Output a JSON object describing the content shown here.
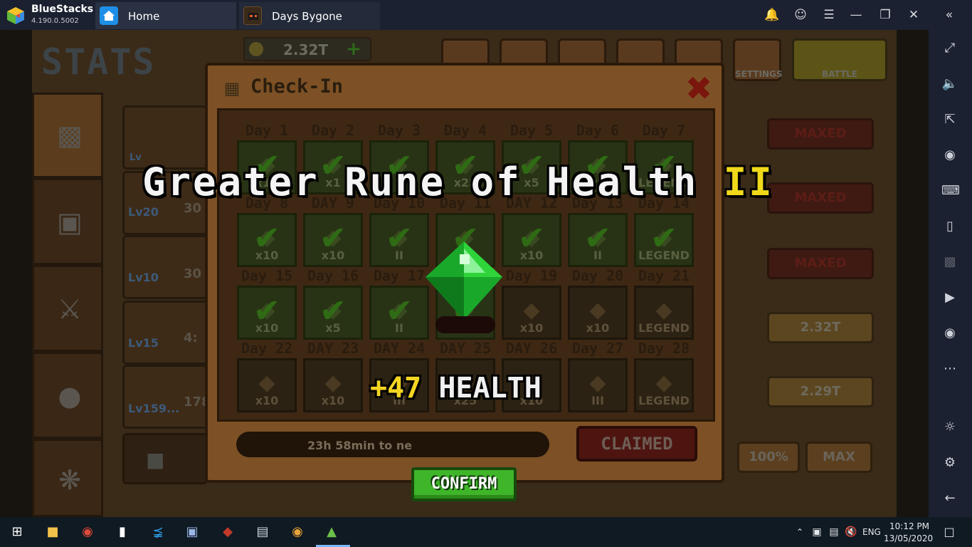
{
  "window": {
    "app_name": "BlueStacks 1",
    "app_version": "4.190.0.5002",
    "tabs": [
      {
        "label": "Home"
      },
      {
        "label": "Days Bygone"
      }
    ]
  },
  "game": {
    "screen_title": "STATS",
    "coins": "2.32T",
    "top_buttons": [
      {
        "label": "SETTINGS"
      },
      {
        "label": "BATTLE"
      }
    ],
    "stat_rows": [
      {
        "level": "Lv",
        "right": "MAXED"
      },
      {
        "level": "Lv20",
        "value": "30",
        "right": "MAXED"
      },
      {
        "level": "Lv10",
        "value": "30",
        "right": "MAXED"
      },
      {
        "level": "Lv15",
        "value": "4:",
        "right": "2.32T"
      },
      {
        "level": "Lv159...",
        "value": "178",
        "right": "2.29T"
      }
    ],
    "bottom_buttons": [
      "100%",
      "MAX"
    ]
  },
  "checkin": {
    "title": "Check-In",
    "days": [
      {
        "label": "Day 1",
        "qty": "x10",
        "claimed": true
      },
      {
        "label": "Day 2",
        "qty": "x1",
        "claimed": true
      },
      {
        "label": "Day 3",
        "qty": "I",
        "claimed": true
      },
      {
        "label": "Day 4",
        "qty": "x25",
        "claimed": true
      },
      {
        "label": "Day 5",
        "qty": "x5",
        "claimed": true
      },
      {
        "label": "Day 6",
        "qty": "x5",
        "claimed": true
      },
      {
        "label": "Day 7",
        "qty": "LEGEND",
        "claimed": true
      },
      {
        "label": "Day 8",
        "qty": "x10",
        "claimed": true
      },
      {
        "label": "DAY 9",
        "qty": "x10",
        "claimed": true
      },
      {
        "label": "Day 10",
        "qty": "II",
        "claimed": true
      },
      {
        "label": "Day 11",
        "qty": "",
        "claimed": true
      },
      {
        "label": "DAY 12",
        "qty": "x10",
        "claimed": true
      },
      {
        "label": "Day 13",
        "qty": "II",
        "claimed": true
      },
      {
        "label": "Day 14",
        "qty": "LEGEND",
        "claimed": true
      },
      {
        "label": "Day 15",
        "qty": "x10",
        "claimed": true
      },
      {
        "label": "Day 16",
        "qty": "x5",
        "claimed": true
      },
      {
        "label": "Day 17",
        "qty": "II",
        "claimed": true
      },
      {
        "label": "",
        "qty": "",
        "claimed": true
      },
      {
        "label": "Day 19",
        "qty": "x10",
        "claimed": false
      },
      {
        "label": "Day 20",
        "qty": "x10",
        "claimed": false
      },
      {
        "label": "Day 21",
        "qty": "LEGEND",
        "claimed": false
      },
      {
        "label": "Day 22",
        "qty": "x10",
        "claimed": false
      },
      {
        "label": "DAY 23",
        "qty": "x10",
        "claimed": false
      },
      {
        "label": "DAY 24",
        "qty": "III",
        "claimed": false
      },
      {
        "label": "DAY 25",
        "qty": "x25",
        "claimed": false
      },
      {
        "label": "DAY 26",
        "qty": "x10",
        "claimed": false
      },
      {
        "label": "Day 27",
        "qty": "III",
        "claimed": false
      },
      {
        "label": "Day 28",
        "qty": "LEGEND",
        "claimed": false
      }
    ],
    "timer_text": "23h 58min to ne",
    "claimed_label": "CLAIMED"
  },
  "reward": {
    "title_main": "Greater Rune of Health",
    "title_roman": "II",
    "amount": "+47",
    "stat": "HEALTH",
    "confirm_label": "CONFIRM"
  },
  "taskbar": {
    "language": "ENG",
    "time": "10:12 PM",
    "date": "13/05/2020"
  },
  "colors": {
    "gem": "#2fd43a",
    "confirm": "#3fb52a",
    "roman": "#f0d91a",
    "amount": "#f4d622"
  }
}
